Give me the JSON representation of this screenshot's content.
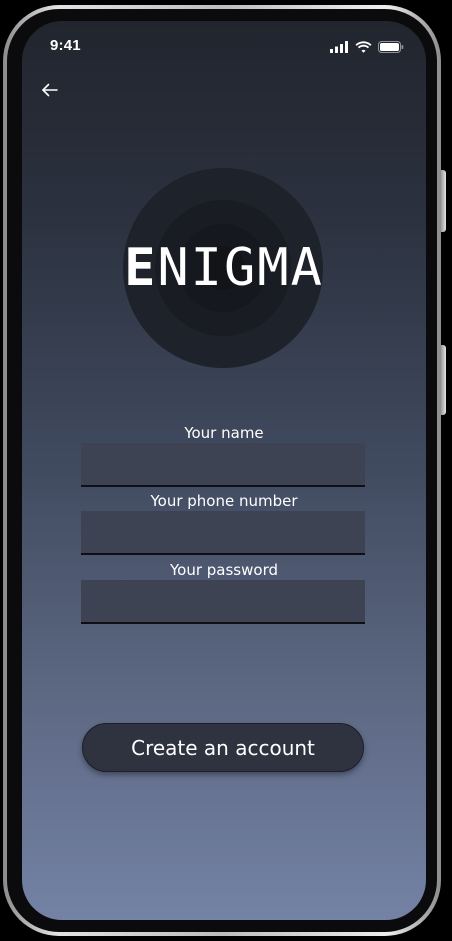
{
  "status_bar": {
    "time": "9:41",
    "icons": [
      "cellular-signal-icon",
      "wifi-icon",
      "battery-icon"
    ]
  },
  "nav": {
    "back_icon": "arrow-left-icon"
  },
  "logo": {
    "first_letter": "E",
    "rest": "NIGMA"
  },
  "form": {
    "name_label": "Your name",
    "name_value": "",
    "phone_label": "Your phone number",
    "phone_value": "",
    "password_label": "Your password",
    "password_value": ""
  },
  "actions": {
    "create_account_label": "Create an account"
  },
  "colors": {
    "gradient_top": "#21252e",
    "gradient_bottom": "#7482a5",
    "input_bg": "#3d4352",
    "button_bg": "#2f3340",
    "text": "#ffffff"
  }
}
